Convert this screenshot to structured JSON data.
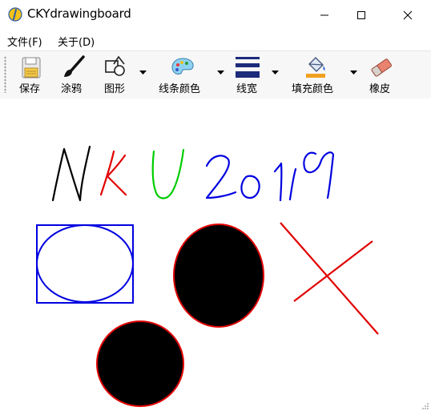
{
  "window": {
    "title": "CKYdrawingboard"
  },
  "menu": {
    "file": "文件(F)",
    "about": "关于(D)"
  },
  "toolbar": {
    "save": "保存",
    "brush": "涂鸦",
    "shape": "图形",
    "line_color": "线条颜色",
    "line_width": "线宽",
    "fill_color": "填充颜色",
    "eraser": "橡皮"
  },
  "colors": {
    "stroke_black": "#000000",
    "stroke_red": "#e00000",
    "stroke_green": "#00cc00",
    "stroke_blue": "#0000e0",
    "fill_black": "#000000"
  }
}
